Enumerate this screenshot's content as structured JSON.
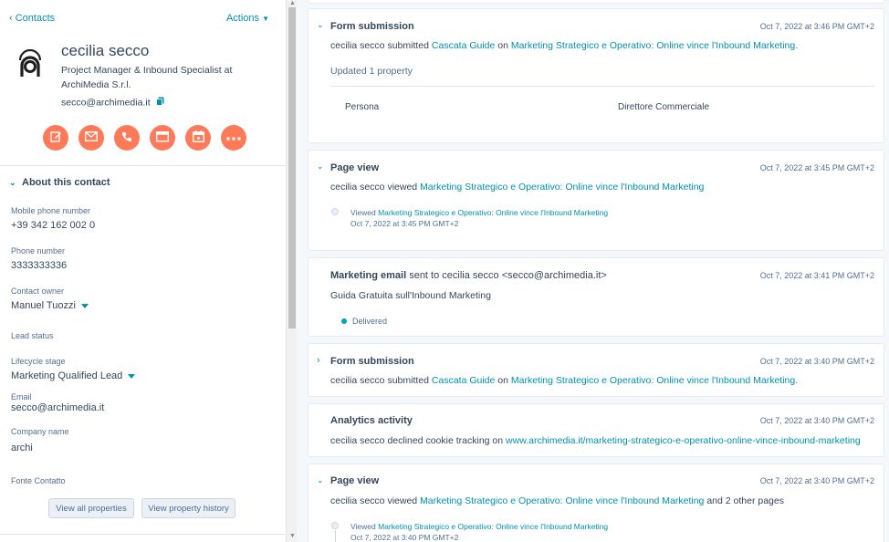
{
  "nav": {
    "back_label": "Contacts",
    "actions_label": "Actions"
  },
  "contact": {
    "name": "cecilia secco",
    "title": "Project Manager & Inbound Specialist at ArchiMedia S.r.l.",
    "email": "secco@archimedia.it"
  },
  "about": {
    "heading": "About this contact",
    "props": [
      {
        "label": "Mobile phone number",
        "value": "+39 342 162 002 0"
      },
      {
        "label": "Phone number",
        "value": "3333333336"
      },
      {
        "label": "Contact owner",
        "value": "Manuel Tuozzi"
      },
      {
        "label": "Lead status",
        "value": ""
      },
      {
        "label": "Lifecycle stage",
        "value": "Marketing Qualified Lead"
      },
      {
        "label": "Email",
        "value": "secco@archimedia.it"
      },
      {
        "label": "Company name",
        "value": "archi"
      },
      {
        "label": "Fonte Contatto",
        "value": ""
      }
    ],
    "view_all_label": "View all properties",
    "view_history_label": "View property history"
  },
  "timeline": {
    "c1": {
      "title": "Form submission",
      "time": "Oct 7, 2022 at 3:46 PM GMT+2",
      "actor": "cecilia secco",
      "verb": " submitted ",
      "form": "Cascata Guide",
      "on": " on ",
      "page": "Marketing Strategico e Operativo: Online vince l'Inbound Marketing.",
      "updated": "Updated 1 property",
      "prop_name": "Persona",
      "prop_value": "Direttore Commerciale"
    },
    "c2": {
      "title": "Page view",
      "time": "Oct 7, 2022 at 3:45 PM GMT+2",
      "actor": "cecilia secco",
      "verb": " viewed ",
      "page": "Marketing Strategico e Operativo: Online vince l'Inbound Marketing",
      "sub_prefix": "Viewed ",
      "sub_page": "Marketing Strategico e Operativo: Online vince l'Inbound Marketing",
      "sub_time": "Oct 7, 2022 at 3:45 PM GMT+2"
    },
    "c3": {
      "title": "Marketing email",
      "title_rest": " sent to cecilia secco <secco@archimedia.it>",
      "time": "Oct 7, 2022 at 3:41 PM GMT+2",
      "email_name": "Guida Gratuita sull'Inbound Marketing",
      "status": "Delivered"
    },
    "c4": {
      "title": "Form submission",
      "time": "Oct 7, 2022 at 3:40 PM GMT+2",
      "actor": "cecilia secco",
      "verb": " submitted ",
      "form": "Cascata Guide",
      "on": " on ",
      "page": "Marketing Strategico e Operativo: Online vince l'Inbound Marketing."
    },
    "c5": {
      "title": "Analytics activity",
      "time": "Oct 7, 2022 at 3:40 PM GMT+2",
      "text": "cecilia secco declined cookie tracking on ",
      "url": "www.archimedia.it/marketing-strategico-e-operativo-online-vince-inbound-marketing"
    },
    "c6": {
      "title": "Page view",
      "time": "Oct 7, 2022 at 3:40 PM GMT+2",
      "actor": "cecilia secco",
      "verb": " viewed ",
      "page": "Marketing Strategico e Operativo: Online vince l'Inbound Marketing",
      "tail": " and 2 other pages",
      "sub_prefix": "Viewed ",
      "sub_page": "Marketing Strategico e Operativo: Online vince l'Inbound Marketing",
      "sub_time": "Oct 7, 2022 at 3:40 PM GMT+2"
    }
  },
  "colors": {
    "accent": "#ff7a59",
    "link": "#0091ae",
    "text": "#33475b",
    "delivered": "#00a4bd"
  }
}
